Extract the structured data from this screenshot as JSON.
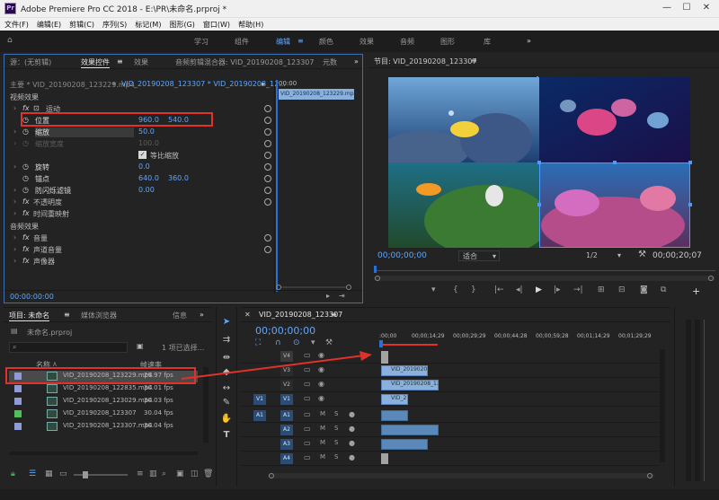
{
  "window": {
    "title": "Adobe Premiere Pro CC 2018 - E:\\PR\\未命名.prproj *",
    "app_icon": "Pr"
  },
  "menu": [
    "文件(F)",
    "编辑(E)",
    "剪辑(C)",
    "序列(S)",
    "标记(M)",
    "图形(G)",
    "窗口(W)",
    "帮助(H)"
  ],
  "workspaces": [
    "学习",
    "组件",
    "编辑",
    "颜色",
    "效果",
    "音频",
    "图形",
    "库"
  ],
  "active_workspace": "编辑",
  "effect_panel": {
    "tabs": [
      "源：(无剪辑)",
      "效果控件",
      "效果",
      "音频剪辑混合器: VID_20190208_123307",
      "元数"
    ],
    "master": "主要 * VID_20190208_123229.mp4",
    "clip": "VID_20190208_123307 * VID_20190208_12...",
    "section_video": "视频效果",
    "motion": "运动",
    "position_label": "位置",
    "position_x": "960.0",
    "position_y": "540.0",
    "scale_label": "缩放",
    "scale_value": "50.0",
    "scale_width_label": "缩放宽度",
    "scale_width_value": "100.0",
    "uniform_scale": "等比缩放",
    "rotation_label": "旋转",
    "rotation_value": "0.0",
    "anchor_label": "锚点",
    "anchor_x": "640.0",
    "anchor_y": "360.0",
    "antiflicker_label": "防闪烁滤镜",
    "antiflicker_value": "0.00",
    "opacity_label": "不透明度",
    "time_remap_label": "时间重映射",
    "section_audio": "音频效果",
    "volume_label": "音量",
    "channel_volume_label": "声道音量",
    "panner_label": "声像器",
    "timecode": "00:00:00:00",
    "mini_time": "00:00",
    "mini_clip": "VID_20190208_123229.mp4"
  },
  "program": {
    "title": "节目: VID_20190208_123307",
    "timecode": "00;00;00;00",
    "fit": "适合",
    "ratio": "1/2",
    "duration": "00;00;20;07"
  },
  "project": {
    "tabs": [
      "项目: 未命名",
      "媒体浏览器",
      "信息"
    ],
    "file": "未命名.prproj",
    "selected_info": "1 项已选择...",
    "col_name": "名称",
    "col_rate": "帧速率",
    "items": [
      {
        "name": "VID_20190208_123229.mp4",
        "rate": "29.97 fps",
        "color": "#8f9bd6"
      },
      {
        "name": "VID_20190208_122835.mp4",
        "rate": "30.01 fps",
        "color": "#8f9bd6"
      },
      {
        "name": "VID_20190208_123029.mp4",
        "rate": "30.03 fps",
        "color": "#8f9bd6"
      },
      {
        "name": "VID_20190208_123307",
        "rate": "30.04 fps",
        "color": "#4fbf5b"
      },
      {
        "name": "VID_20190208_123307.mp4",
        "rate": "30.04 fps",
        "color": "#8f9bd6"
      }
    ]
  },
  "timeline": {
    "tab": "VID_20190208_123307",
    "timecode": "00;00;00;00",
    "ruler": [
      ":00;00",
      "00;00;14;29",
      "00;00;29;29",
      "00;00;44;28",
      "00;00;59;28",
      "00;01;14;29",
      "00;01;29;29"
    ],
    "video_tracks": [
      "V4",
      "V3",
      "V2",
      "V1"
    ],
    "audio_tracks": [
      "A1",
      "A2",
      "A3",
      "A4"
    ],
    "source_v": "V1",
    "source_a": "A1",
    "clips": {
      "v3": "VID_20190208",
      "v2": "VID_20190208_12",
      "v1": "VID_2"
    }
  }
}
